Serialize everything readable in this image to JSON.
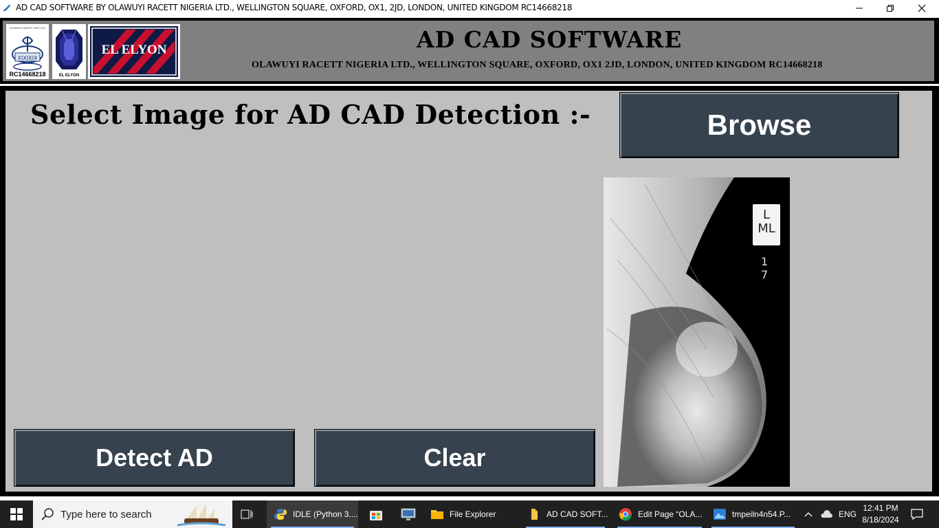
{
  "window": {
    "title": "AD CAD SOFTWARE BY OLAWUYI RACETT NIGERIA LTD., WELLINGTON SQUARE, OXFORD, OX1, 2JD, LONDON, UNITED KINGDOM RC14668218"
  },
  "header": {
    "logo1_caption": "RC14668218",
    "logo1_tiny": "OLAWUYI RACETT NIG LTD",
    "logo2_caption": "EL ELYON",
    "logo3_caption": "EL ELYON",
    "app_title": "AD CAD SOFTWARE",
    "subtitle": "OLAWUYI RACETT NIGERIA LTD., WELLINGTON SQUARE, OXFORD, OX1 2JD, LONDON, UNITED KINGDOM RC14668218"
  },
  "main": {
    "select_label": "Select Image for AD CAD Detection :-",
    "browse_label": "Browse",
    "detect_label": "Detect AD",
    "clear_label": "Clear",
    "image_marker_line1": "L",
    "image_marker_line2": "ML",
    "image_marker_number": "1 7"
  },
  "taskbar": {
    "search_placeholder": "Type here to search",
    "items": [
      {
        "label": "IDLE (Python 3....",
        "icon": "python-icon"
      },
      {
        "label": "",
        "icon": "store-icon"
      },
      {
        "label": "",
        "icon": "monitor-icon"
      },
      {
        "label": "File Explorer",
        "icon": "folder-icon"
      },
      {
        "label": "AD CAD SOFT...",
        "icon": "app-icon"
      },
      {
        "label": "Edit Page “OLA...",
        "icon": "chrome-icon"
      },
      {
        "label": "tmpeiln4n54.P...",
        "icon": "photos-icon"
      }
    ],
    "language": "ENG",
    "time": "12:41 PM",
    "date": "8/18/2024"
  },
  "colors": {
    "button_bg": "#36434f",
    "header_bg": "#808080",
    "main_bg": "#bfbfbf",
    "taskbar_bg": "#202020"
  }
}
